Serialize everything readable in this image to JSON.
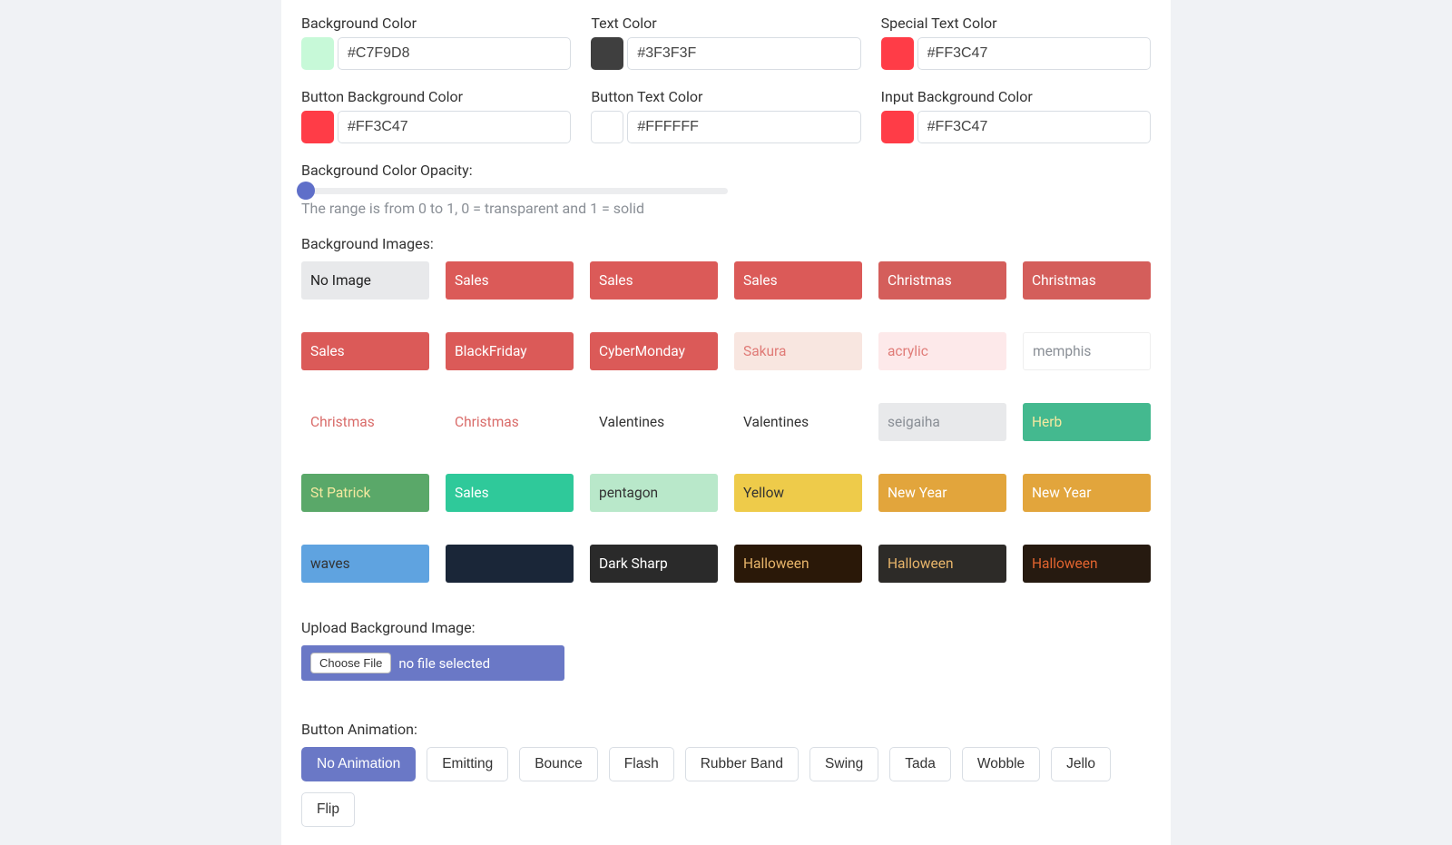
{
  "colors": {
    "background": {
      "label": "Background Color",
      "value": "#C7F9D8",
      "swatch": "#c7f9d8"
    },
    "text": {
      "label": "Text Color",
      "value": "#3F3F3F",
      "swatch": "#3f3f3f"
    },
    "special_text": {
      "label": "Special Text Color",
      "value": "#FF3C47",
      "swatch": "#ff3c47"
    },
    "button_bg": {
      "label": "Button Background Color",
      "value": "#FF3C47",
      "swatch": "#ff3c47"
    },
    "button_text": {
      "label": "Button Text Color",
      "value": "#FFFFFF",
      "swatch": "#ffffff"
    },
    "input_bg": {
      "label": "Input Background Color",
      "value": "#FF3C47",
      "swatch": "#ff3c47"
    }
  },
  "opacity": {
    "label": "Background Color Opacity:",
    "helper": "The range is from 0 to 1, 0 = transparent and 1 = solid"
  },
  "bg_section_label": "Background Images:",
  "bg_tiles": [
    {
      "label": "No Image",
      "cls": "no-image"
    },
    {
      "label": "Sales",
      "cls": "sales-red"
    },
    {
      "label": "Sales",
      "cls": "sales-red"
    },
    {
      "label": "Sales",
      "cls": "sales-red"
    },
    {
      "label": "Christmas",
      "cls": "christmas-red"
    },
    {
      "label": "Christmas",
      "cls": "christmas-red"
    },
    {
      "label": "Sales",
      "cls": "sales-red"
    },
    {
      "label": "BlackFriday",
      "cls": "blackfriday"
    },
    {
      "label": "CyberMonday",
      "cls": "cybermonday"
    },
    {
      "label": "Sakura",
      "cls": "sakura"
    },
    {
      "label": "acrylic",
      "cls": "acrylic"
    },
    {
      "label": "memphis",
      "cls": "memphis"
    },
    {
      "label": "Christmas",
      "cls": "christmas-light"
    },
    {
      "label": "Christmas",
      "cls": "christmas-light2"
    },
    {
      "label": "Valentines",
      "cls": "valentines-light"
    },
    {
      "label": "Valentines",
      "cls": "valentines-light2"
    },
    {
      "label": "seigaiha",
      "cls": "seigaiha"
    },
    {
      "label": "Herb",
      "cls": "herb"
    },
    {
      "label": "St Patrick",
      "cls": "stpatrick"
    },
    {
      "label": "Sales",
      "cls": "sales-teal"
    },
    {
      "label": "pentagon",
      "cls": "pentagon"
    },
    {
      "label": "Yellow",
      "cls": "yellow"
    },
    {
      "label": "New Year",
      "cls": "newyear-gold"
    },
    {
      "label": "New Year",
      "cls": "newyear-gold2"
    },
    {
      "label": "waves",
      "cls": "waves"
    },
    {
      "label": "",
      "cls": "dark-blue"
    },
    {
      "label": "Dark Sharp",
      "cls": "dark-sharp"
    },
    {
      "label": "Halloween",
      "cls": "halloween-pump"
    },
    {
      "label": "Halloween",
      "cls": "halloween-ghost"
    },
    {
      "label": "Halloween",
      "cls": "halloween-bat"
    }
  ],
  "upload": {
    "label": "Upload Background Image:",
    "button": "Choose File",
    "status": "no file selected"
  },
  "animation": {
    "label": "Button Animation:",
    "options": [
      "No Animation",
      "Emitting",
      "Bounce",
      "Flash",
      "Rubber Band",
      "Swing",
      "Tada",
      "Wobble",
      "Jello",
      "Flip"
    ],
    "active": "No Animation"
  }
}
